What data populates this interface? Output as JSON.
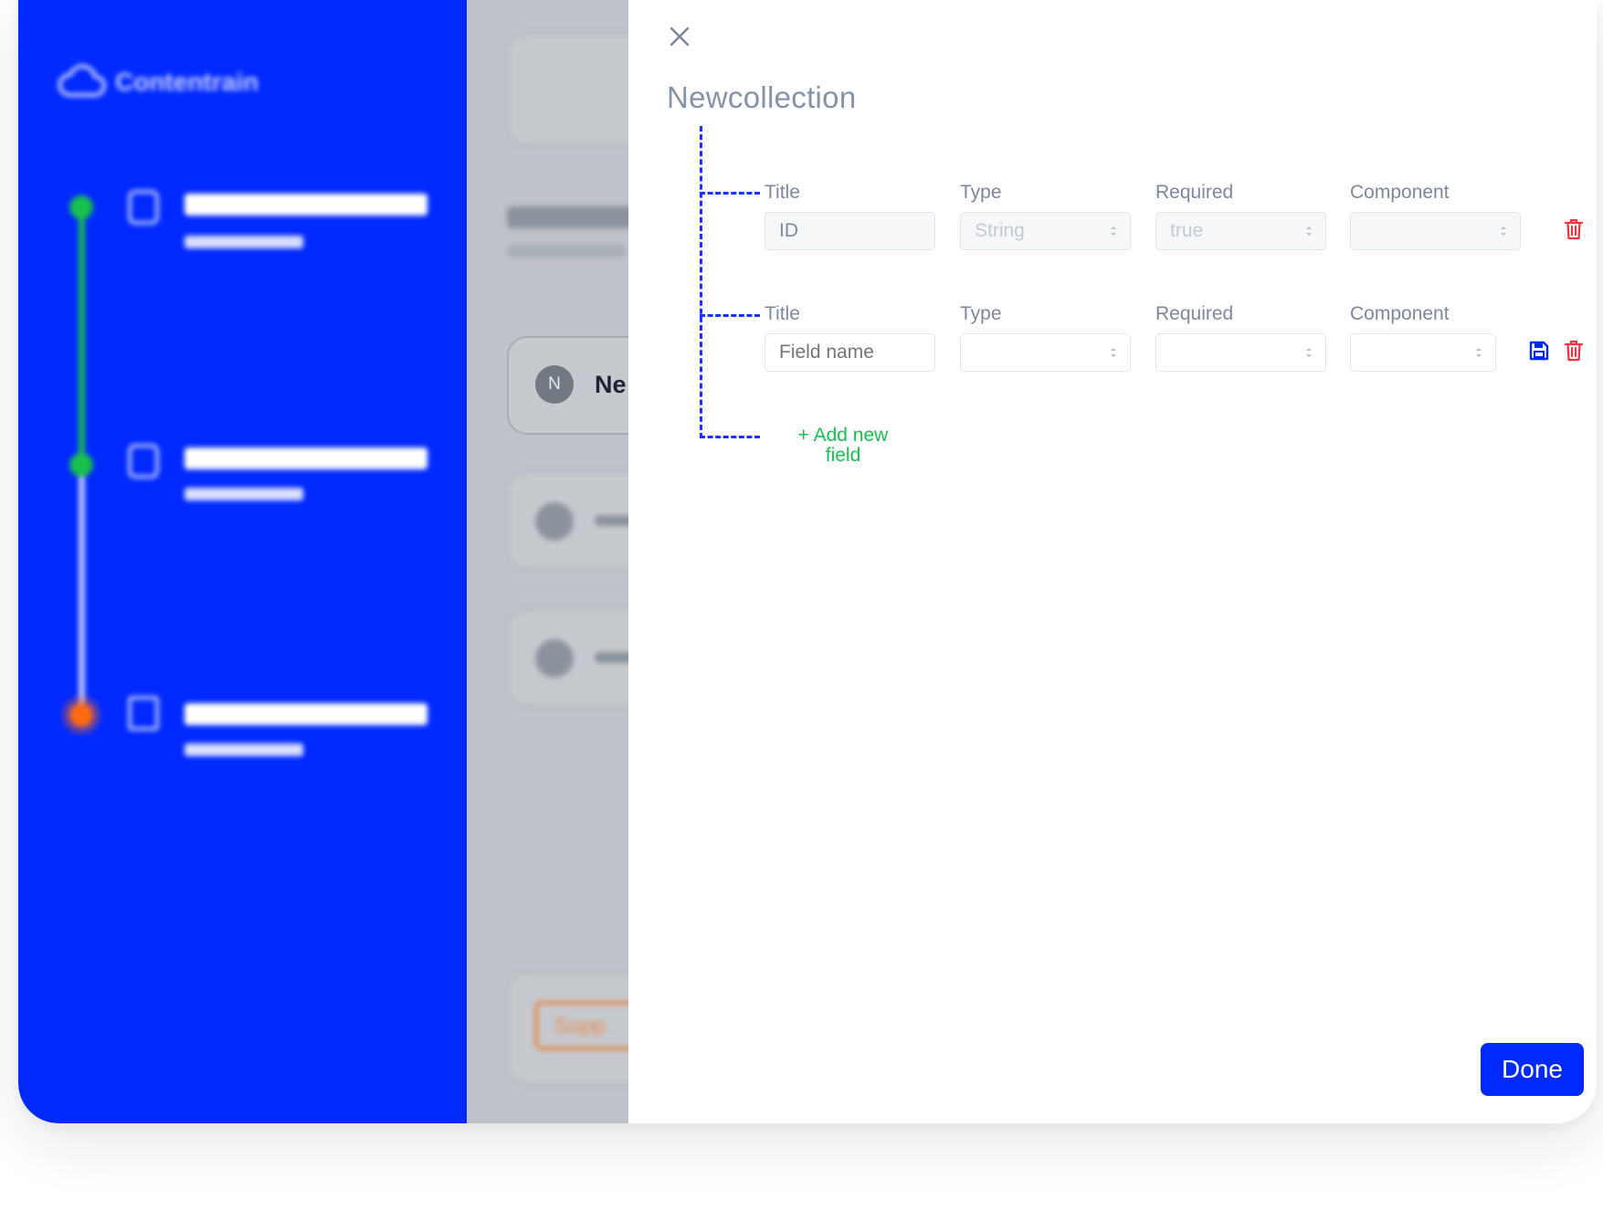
{
  "app": {
    "logo_text": "Contentrain"
  },
  "background": {
    "collection_avatar_letter": "N",
    "collection_name_partial": "Ne",
    "support_button_partial": "Supp"
  },
  "panel": {
    "title": "Newcollection",
    "columns": {
      "title": "Title",
      "type": "Type",
      "required": "Required",
      "component": "Component"
    },
    "rows": [
      {
        "title_value": "ID",
        "type_value": "String",
        "required_value": "true",
        "component_value": ""
      },
      {
        "title_placeholder": "Field name",
        "type_value": "",
        "required_value": "",
        "component_value": ""
      }
    ],
    "add_field_label": "+ Add new field",
    "done_label": "Done"
  },
  "colors": {
    "brand_blue": "#0029ff",
    "success_green": "#16c14f",
    "danger_red": "#f0313e",
    "step_orange": "#ff6a13"
  }
}
